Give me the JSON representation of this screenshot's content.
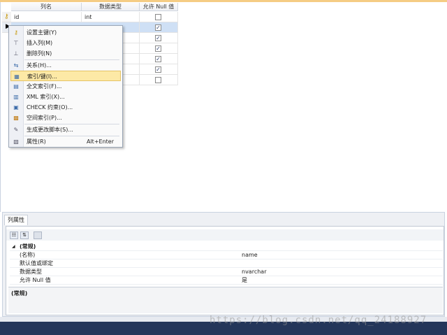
{
  "grid": {
    "headers": {
      "column_name": "列名",
      "data_type": "数据类型",
      "allow_null": "允许 Null 值"
    },
    "rows": [
      {
        "name": "id",
        "type": "int",
        "allow_null": false,
        "primary_key": true
      },
      {
        "name": "",
        "type": "",
        "allow_null": true,
        "selected": true
      },
      {
        "name": "",
        "type": "",
        "allow_null": true
      },
      {
        "name": "",
        "type": "",
        "allow_null": true
      },
      {
        "name": "",
        "type": "",
        "allow_null": true
      },
      {
        "name": "",
        "type": "",
        "allow_null": true
      },
      {
        "name": "",
        "type": "",
        "allow_null": false
      }
    ]
  },
  "context_menu": {
    "items": [
      {
        "label": "设置主键(Y)",
        "icon": "key-icon"
      },
      {
        "label": "插入列(M)",
        "icon": "insert-column-icon"
      },
      {
        "label": "删除列(N)",
        "icon": "delete-column-icon"
      },
      {
        "label": "关系(H)...",
        "icon": "relationship-icon"
      },
      {
        "label": "索引/键(I)...",
        "icon": "index-key-icon",
        "highlighted": true
      },
      {
        "label": "全文索引(F)...",
        "icon": "fulltext-index-icon"
      },
      {
        "label": "XML 索引(X)...",
        "icon": "xml-index-icon"
      },
      {
        "label": "CHECK 约束(O)...",
        "icon": "check-constraint-icon"
      },
      {
        "label": "空间索引(P)...",
        "icon": "spatial-index-icon"
      },
      {
        "label": "生成更改脚本(S)...",
        "icon": "generate-script-icon"
      },
      {
        "label": "属性(R)",
        "shortcut": "Alt+Enter",
        "icon": "properties-icon"
      }
    ]
  },
  "properties": {
    "tab_label": "列属性",
    "section": "(常规)",
    "rows": [
      {
        "key": "(名称)",
        "value": "name"
      },
      {
        "key": "默认值或绑定",
        "value": ""
      },
      {
        "key": "数据类型",
        "value": "nvarchar"
      },
      {
        "key": "允许 Null 值",
        "value": "是"
      }
    ],
    "description_title": "(常规)"
  },
  "watermark": "https://blog.csdn.net/qq_24188927",
  "colors": {
    "accent_strip": "#f5cc84",
    "menu_highlight": "#fde9a6",
    "bottom_bar": "#24365a"
  }
}
